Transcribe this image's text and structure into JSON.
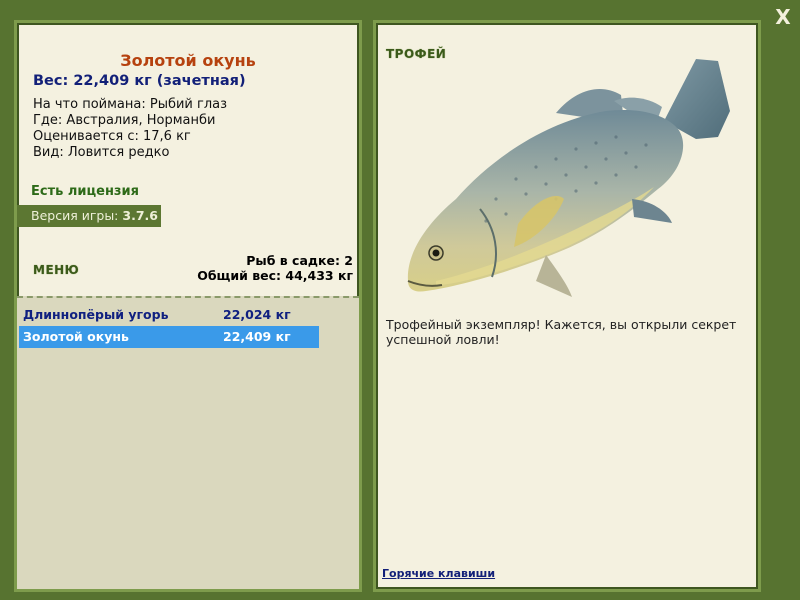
{
  "close_label": "X",
  "fish": {
    "name": "Золотой окунь",
    "weight_line": "Вес: 22,409 кг (зачетная)",
    "caught_on": "На что поймана: Рыбий глаз",
    "location": "Где: Австралия, Норманби",
    "valued_from": "Оценивается с: 17,6 кг",
    "kind": "Вид: Ловится редко"
  },
  "license_text": "Есть лицензия",
  "version": {
    "label": "Версия игры:",
    "value": "3.7.6"
  },
  "menu_label": "МЕНЮ",
  "keepnet": {
    "count_line": "Рыб в садке: 2",
    "total_line": "Общий вес: 44,433 кг"
  },
  "catch_list": [
    {
      "name": "Длиннопёрый угорь",
      "weight": "22,024 кг",
      "selected": false
    },
    {
      "name": "Золотой окунь",
      "weight": "22,409 кг",
      "selected": true
    }
  ],
  "trophy": {
    "heading": "ТРОФЕЙ",
    "message": "Трофейный экземпляр! Кажется, вы открыли секрет успешной ловли!"
  },
  "hotkeys_label": "Горячие клавиши",
  "colors": {
    "background": "#577330",
    "panel": "#f4f1e0",
    "fish_title": "#b6420f",
    "selected_row": "#3a9ae9"
  }
}
